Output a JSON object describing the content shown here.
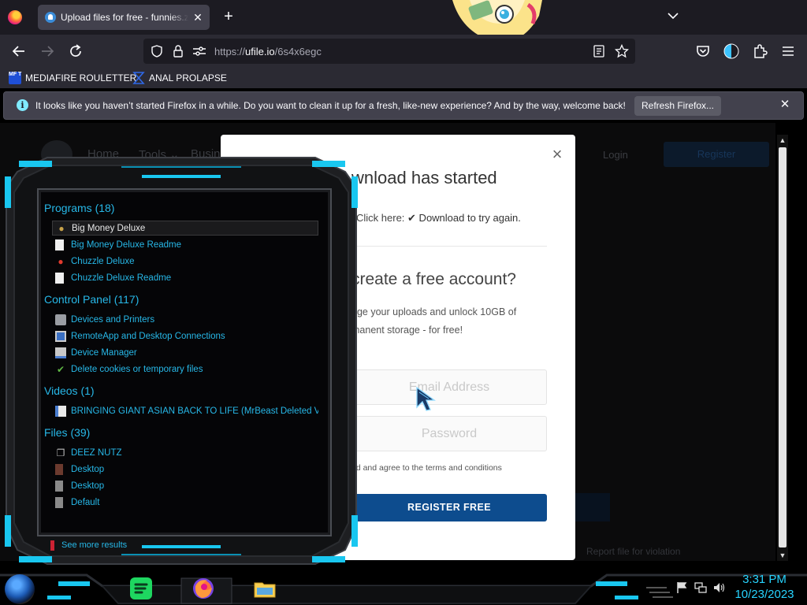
{
  "browser": {
    "tab_title": "Upload files for free - funnies.zip - ufile.io",
    "tab_close": "✕",
    "new_tab": "+",
    "url_prefix": "https://",
    "url_host": "ufile.io",
    "url_path": "/6s4x6egc"
  },
  "bookmarks": [
    {
      "label": "MEDIAFIRE ROULETTER",
      "icon": "mediafire-icon",
      "icon_text": "MF T"
    },
    {
      "label": "ANAL PROLAPSE",
      "icon": "hourglass-icon"
    }
  ],
  "notification": {
    "text": "It looks like you haven’t started Firefox in a while. Do you want to clean it up for a fresh, like-new experience? And by the way, welcome back!",
    "button": "Refresh Firefox...",
    "close": "✕"
  },
  "site": {
    "nav": [
      "Home",
      "Tools ⌄",
      "Busin"
    ],
    "login": "Login",
    "register": "Register",
    "report": "Report file for violation"
  },
  "modal": {
    "close": "×",
    "title": "wnload has started",
    "click_text": "Click here:",
    "click_link": "✔ Download to try again.",
    "heading": "create a free account?",
    "description": "age your uploads and unlock 10GB of manent storage - for free!",
    "email_placeholder": "Email Address",
    "password_placeholder": "Password",
    "terms": "ad and agree to the terms and conditions",
    "register_button": "REGISTER FREE"
  },
  "start_menu": {
    "categories": [
      {
        "label": "Programs (18)",
        "items": [
          {
            "label": "Big Money Deluxe",
            "icon": "moneybag-icon",
            "selected": true
          },
          {
            "label": "Big Money Deluxe Readme",
            "icon": "document-icon"
          },
          {
            "label": "Chuzzle Deluxe",
            "icon": "chuzzle-icon"
          },
          {
            "label": "Chuzzle Deluxe Readme",
            "icon": "document-icon"
          }
        ]
      },
      {
        "label": "Control Panel (117)",
        "items": [
          {
            "label": "Devices and Printers",
            "icon": "printer-icon"
          },
          {
            "label": "RemoteApp and Desktop Connections",
            "icon": "remote-desktop-icon"
          },
          {
            "label": "Device Manager",
            "icon": "device-manager-icon"
          },
          {
            "label": "Delete cookies or temporary files",
            "icon": "internet-options-icon"
          }
        ]
      },
      {
        "label": "Videos (1)",
        "items": [
          {
            "label": "BRINGING GIANT ASIAN BACK TO LIFE (MrBeast Deleted Vi...",
            "icon": "video-file-icon"
          }
        ]
      },
      {
        "label": "Files (39)",
        "items": [
          {
            "label": "DEEZ NUTZ",
            "icon": "library-icon"
          },
          {
            "label": "Desktop",
            "icon": "desktop-folder-icon"
          },
          {
            "label": "Desktop",
            "icon": "desktop-shortcut-icon"
          },
          {
            "label": "Default",
            "icon": "default-folder-icon"
          }
        ]
      }
    ],
    "see_more": "See more results"
  },
  "taskbar": {
    "time": "3:31 PM",
    "date": "10/23/2023",
    "apps": [
      "spotify-icon",
      "firefox-icon",
      "file-explorer-icon"
    ]
  },
  "colors": {
    "accent_cyan": "#27b8e8",
    "register_blue": "#0d4c8e",
    "firefox_dark": "#2b2a33"
  }
}
